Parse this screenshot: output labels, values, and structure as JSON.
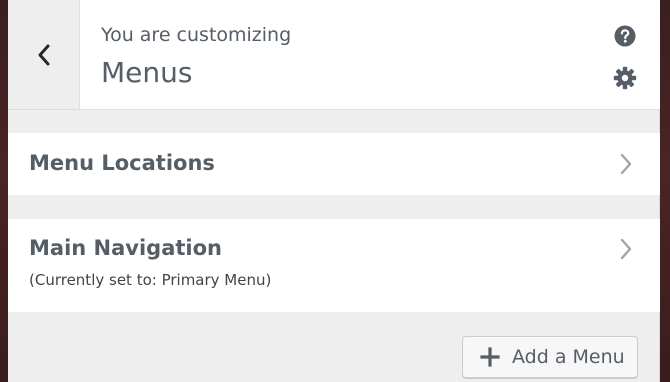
{
  "header": {
    "eyebrow": "You are customizing",
    "title": "Menus",
    "back_icon": "chevron-left-icon",
    "help_icon": "help-icon",
    "settings_icon": "gear-icon"
  },
  "sections": [
    {
      "title": "Menu Locations",
      "icon": "chevron-right-icon"
    },
    {
      "title": "Main Navigation",
      "description": "(Currently set to: Primary Menu)",
      "icon": "chevron-right-icon"
    }
  ],
  "actions": {
    "add_menu_label": "Add a Menu",
    "add_menu_icon": "plus-icon"
  },
  "colors": {
    "panel_bg": "#eeeeee",
    "text": "#555d66",
    "backdrop": "#3a1f1f"
  }
}
